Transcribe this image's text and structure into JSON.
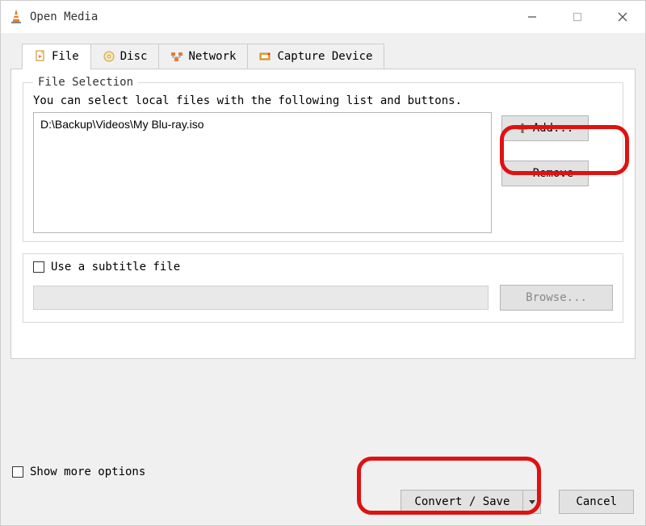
{
  "window": {
    "title": "Open Media"
  },
  "win_controls": {
    "min": "minimize",
    "max": "maximize",
    "close": "close"
  },
  "tabs": {
    "file": "File",
    "disc": "Disc",
    "network": "Network",
    "capture": "Capture Device"
  },
  "file_group": {
    "title": "File Selection",
    "desc": "You can select local files with the following list and buttons.",
    "file_list": "D:\\Backup\\Videos\\My Blu-ray.iso",
    "add_label": "Add...",
    "remove_label": "Remove"
  },
  "subtitle": {
    "check_label": "Use a subtitle file",
    "browse_label": "Browse..."
  },
  "more_options_label": "Show more options",
  "actions": {
    "convert_label": "Convert / Save",
    "cancel_label": "Cancel"
  }
}
